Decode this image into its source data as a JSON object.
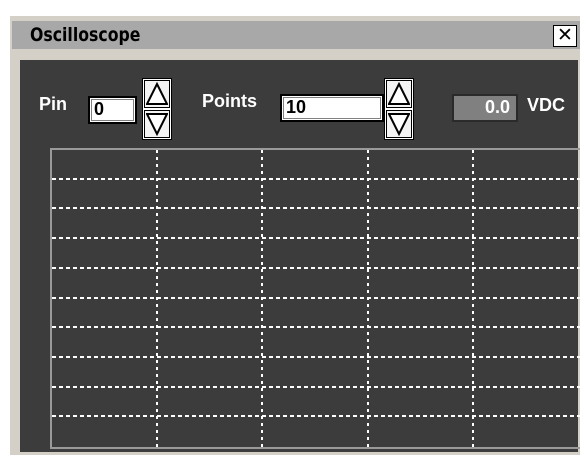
{
  "window": {
    "title": "Oscilloscope",
    "close_glyph": "✕"
  },
  "controls": {
    "pin_label": "Pin",
    "pin_value": "0",
    "points_label": "Points",
    "points_value": "10",
    "reading_value": "0.0",
    "reading_unit": "VDC"
  },
  "icons": {
    "close": "close-icon",
    "up": "arrow-up-icon",
    "down": "arrow-down-icon"
  },
  "plot": {
    "grid": true,
    "vertical_divisions": 5,
    "horizontal_divisions": 10,
    "traces": []
  },
  "colors": {
    "panel": "#3c3c3c",
    "grid": "#ffffff",
    "titlebar": "#a8a8a8"
  }
}
